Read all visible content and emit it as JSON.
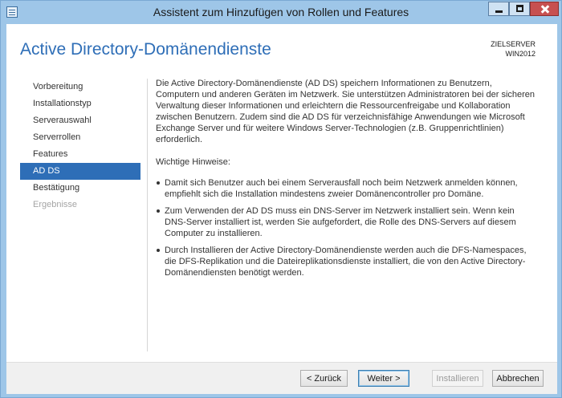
{
  "window": {
    "title": "Assistent zum Hinzufügen von Rollen und Features"
  },
  "header": {
    "title": "Active Directory-Domänendienste",
    "server_label": "ZIELSERVER",
    "server_name": "WIN2012"
  },
  "nav": {
    "items": [
      {
        "label": "Vorbereitung",
        "state": "normal"
      },
      {
        "label": "Installationstyp",
        "state": "normal"
      },
      {
        "label": "Serverauswahl",
        "state": "normal"
      },
      {
        "label": "Serverrollen",
        "state": "normal"
      },
      {
        "label": "Features",
        "state": "normal"
      },
      {
        "label": "AD DS",
        "state": "selected"
      },
      {
        "label": "Bestätigung",
        "state": "normal"
      },
      {
        "label": "Ergebnisse",
        "state": "disabled"
      }
    ]
  },
  "content": {
    "intro": "Die Active Directory-Domänendienste (AD DS) speichern Informationen zu Benutzern, Computern und anderen Geräten im Netzwerk. Sie unterstützen Administratoren bei der sicheren Verwaltung dieser Informationen und erleichtern die Ressourcenfreigabe und Kollaboration zwischen Benutzern. Zudem sind die AD DS für verzeichnisfähige Anwendungen wie Microsoft Exchange Server und für weitere Windows Server-Technologien (z.B. Gruppenrichtlinien) erforderlich.",
    "notes_heading": "Wichtige Hinweise:",
    "bullets": [
      "Damit sich Benutzer auch bei einem Serverausfall noch beim Netzwerk anmelden können, empfiehlt sich die Installation mindestens zweier Domänencontroller pro Domäne.",
      "Zum Verwenden der AD DS muss ein DNS-Server im Netzwerk installiert sein. Wenn kein DNS-Server installiert ist, werden Sie aufgefordert, die Rolle des DNS-Servers auf diesem Computer zu installieren.",
      "Durch Installieren der Active Directory-Domänendienste werden auch die DFS-Namespaces, die DFS-Replikation und die Dateireplikationsdienste installiert, die von den Active Directory-Domänendiensten benötigt werden."
    ]
  },
  "footer": {
    "back_label": "< Zurück",
    "next_label": "Weiter >",
    "install_label": "Installieren",
    "cancel_label": "Abbrechen"
  },
  "colors": {
    "accent": "#2e6eb7",
    "title_bar": "#9ec6e8",
    "close_button": "#c75050"
  }
}
